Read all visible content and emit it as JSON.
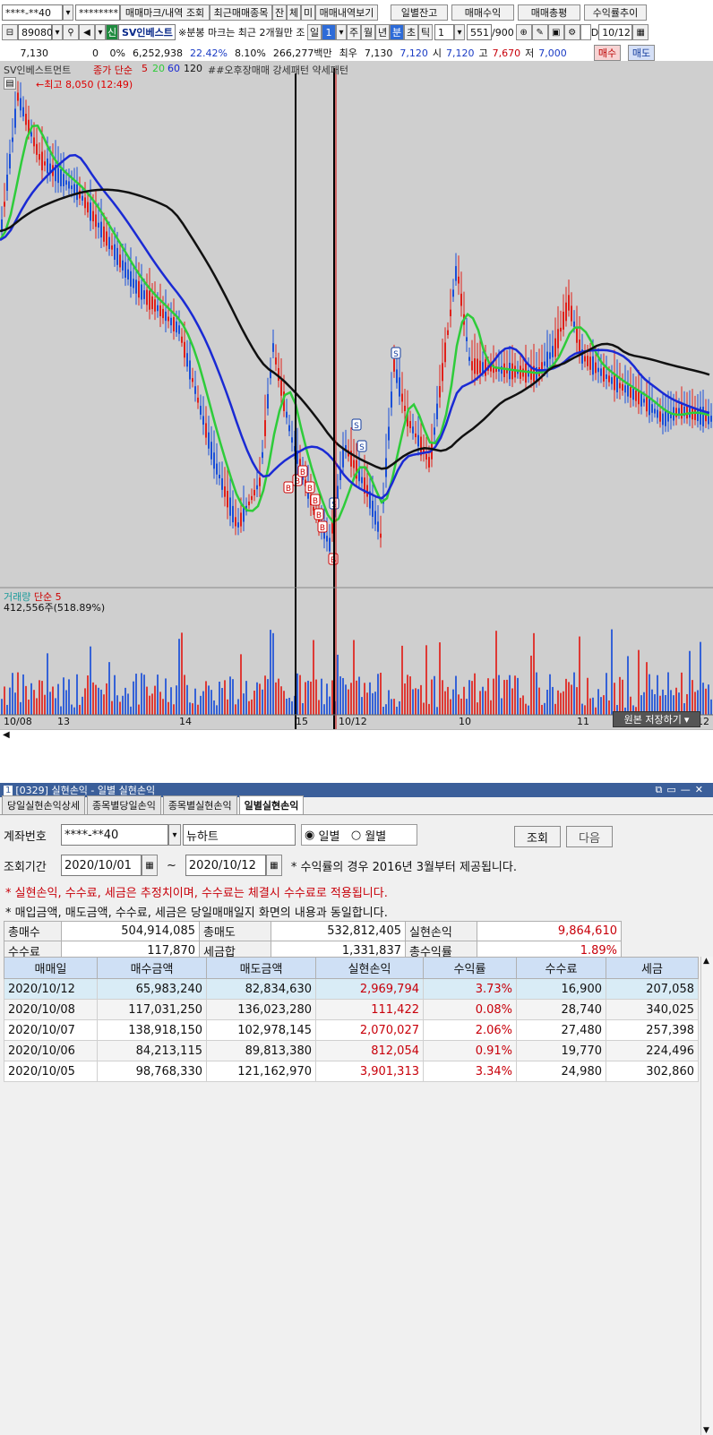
{
  "toolbar1": {
    "account": "****-**40",
    "password": "********",
    "btn_trade_marks": "매매마크/내역 조회",
    "btn_recent_items": "최근매매종목",
    "btn_jan": "잔",
    "btn_che": "체",
    "btn_mi": "미",
    "btn_trade_history": "매매내역보기",
    "btn_daily_balance": "일별잔고",
    "btn_trade_profit": "매매수익",
    "btn_trade_summary": "매매총평",
    "btn_return_trend": "수익률추이"
  },
  "toolbar2": {
    "code": "89080",
    "badge_new": "신",
    "stock_name": "SV인베스트",
    "note": "※분봉 마크는 최근 2개월만 조",
    "periods": [
      "일",
      "1",
      "주",
      "월",
      "년",
      "분",
      "초",
      "틱"
    ],
    "interval": "1",
    "count": "551",
    "count_max": "/900",
    "date": "10/12"
  },
  "quote": {
    "price": "7,130",
    "change": "0",
    "change_pct": "0%",
    "volume": "6,252,938",
    "turnover_pct": "22.42%",
    "ratio": "8.10%",
    "amount": "266,277백만",
    "prev_label": "최우",
    "prev_price": "7,130",
    "ask": "7,120",
    "open_label": "시",
    "open": "7,120",
    "high_label": "고",
    "high": "7,670",
    "low_label": "저",
    "low": "7,000",
    "buy": "매수",
    "sell": "매도"
  },
  "chart": {
    "legend_name": "SV인베스트먼트",
    "legend_ma": "종가 단순",
    "legend_ma_periods": [
      "5",
      "20",
      "60",
      "120"
    ],
    "legend_patterns": "##오후장매매 강세패턴 약세패턴",
    "high_marker": "최고 8,050 (12:49)",
    "volume_label": "거래량",
    "volume_ma": "단순 5",
    "volume_value": "412,556주(518.89%)",
    "x_labels": [
      "10/08",
      "13",
      "14",
      "15",
      "10/12",
      "10",
      "11",
      "12"
    ],
    "save_button": "원본 저장하기",
    "buy_marker": "B",
    "sell_marker": "S",
    "colors": {
      "ma5": "#d42020",
      "ma20": "#2ecc3a",
      "ma60": "#1a2ad4",
      "ma120": "#101010",
      "up": "#e0201a",
      "down": "#1a4fd8"
    }
  },
  "window": {
    "title": "[0329] 실현손익 - 일별 실현손익",
    "tabs": [
      "당일실현손익상세",
      "종목별당일손익",
      "종목별실현손익",
      "일별실현손익"
    ],
    "account_label": "계좌번호",
    "account": "****-**40",
    "account_name": "뉴하트",
    "radio_daily": "일별",
    "radio_monthly": "월별",
    "btn_query": "조회",
    "btn_next": "다음",
    "period_label": "조회기간",
    "date_from": "2020/10/01",
    "tilde": "~",
    "date_to": "2020/10/12",
    "note_return": "* 수익률의 경우 2016년 3월부터 제공됩니다.",
    "note_red": "* 실현손익, 수수료, 세금은 추정치이며, 수수료는 체결시 수수료로 적용됩니다.",
    "note_info": "* 매입금액, 매도금액, 수수료, 세금은 당일매매일지 화면의 내용과 동일합니다."
  },
  "summary": {
    "total_buy_label": "총매수",
    "total_buy": "504,914,085",
    "total_sell_label": "총매도",
    "total_sell": "532,812,405",
    "realized_label": "실현손익",
    "realized": "9,864,610",
    "fee_label": "수수료",
    "fee": "117,870",
    "tax_label": "세금합",
    "tax": "1,331,837",
    "total_return_label": "총수익률",
    "total_return": "1.89%"
  },
  "daily": {
    "headers": [
      "매매일",
      "매수금액",
      "매도금액",
      "실현손익",
      "수익률",
      "수수료",
      "세금"
    ],
    "rows": [
      [
        "2020/10/12",
        "65,983,240",
        "82,834,630",
        "2,969,794",
        "3.73%",
        "16,900",
        "207,058"
      ],
      [
        "2020/10/08",
        "117,031,250",
        "136,023,280",
        "111,422",
        "0.08%",
        "28,740",
        "340,025"
      ],
      [
        "2020/10/07",
        "138,918,150",
        "102,978,145",
        "2,070,027",
        "2.06%",
        "27,480",
        "257,398"
      ],
      [
        "2020/10/06",
        "84,213,115",
        "89,813,380",
        "812,054",
        "0.91%",
        "19,770",
        "224,496"
      ],
      [
        "2020/10/05",
        "98,768,330",
        "121,162,970",
        "3,901,313",
        "3.34%",
        "24,980",
        "302,860"
      ]
    ]
  }
}
